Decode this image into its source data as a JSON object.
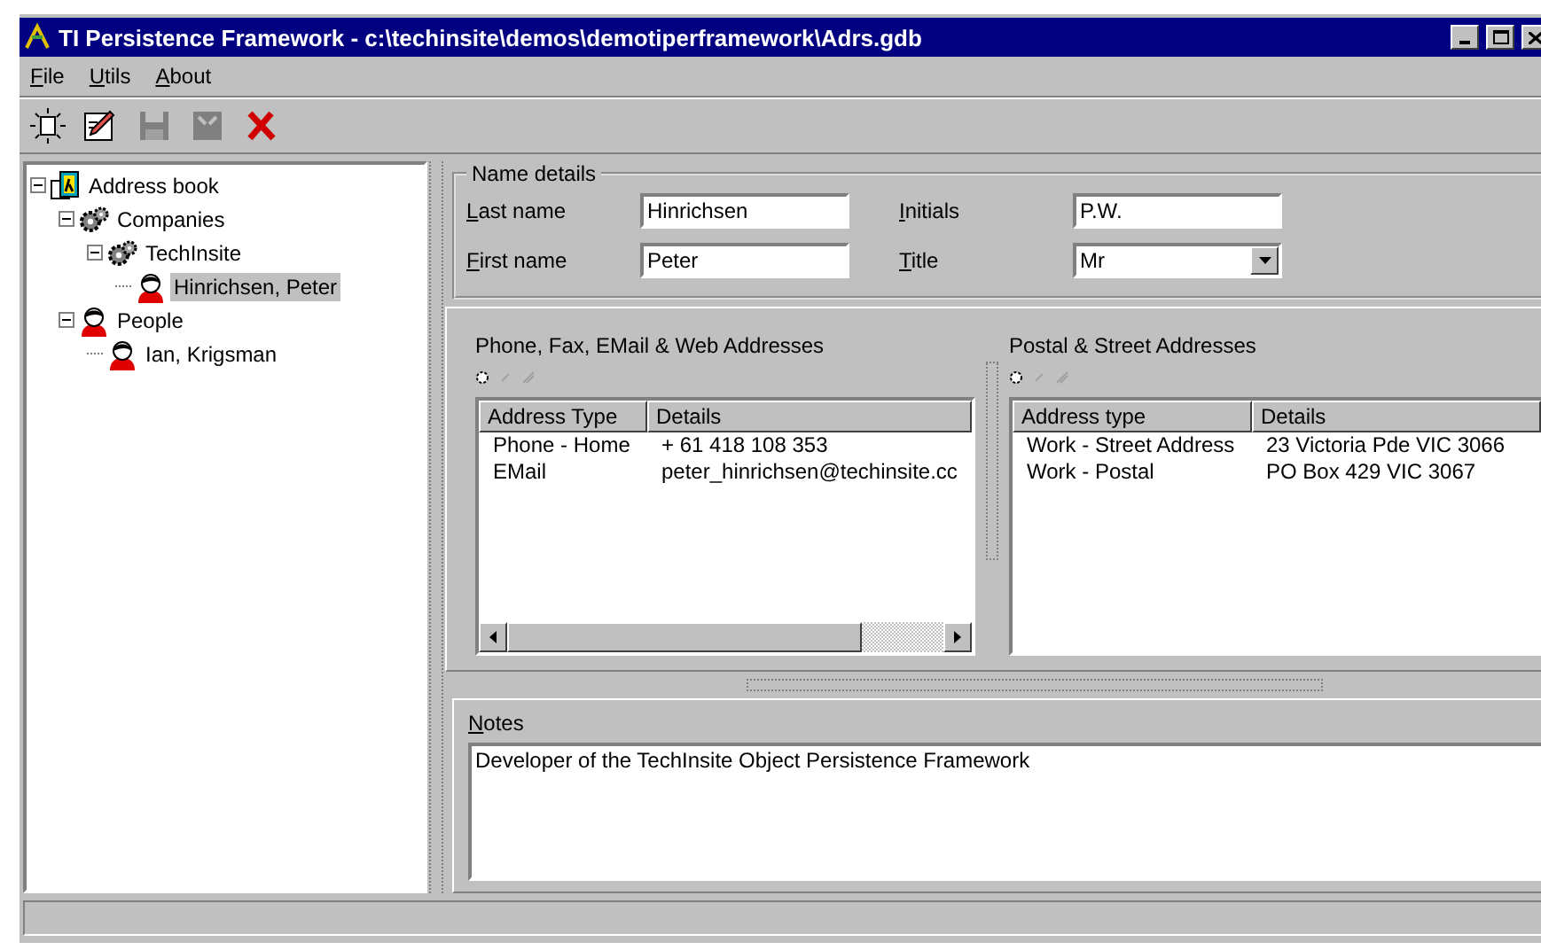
{
  "window": {
    "title": "TI Persistence Framework - c:\\techinsite\\demos\\demotiperframework\\Adrs.gdb"
  },
  "menu": [
    {
      "label": "File"
    },
    {
      "label": "Utils"
    },
    {
      "label": "About"
    }
  ],
  "toolbar": [
    {
      "kind": "new",
      "disabled": false
    },
    {
      "kind": "edit",
      "disabled": false
    },
    {
      "kind": "save",
      "disabled": true
    },
    {
      "kind": "cancel",
      "disabled": true
    },
    {
      "kind": "delete",
      "disabled": false
    }
  ],
  "tree": [
    {
      "label": "Address book",
      "kind": "book",
      "expanded": true,
      "selected": false,
      "children": [
        {
          "label": "Companies",
          "kind": "group",
          "expanded": true,
          "selected": false,
          "children": [
            {
              "label": "TechInsite",
              "kind": "group",
              "expanded": true,
              "selected": false,
              "children": [
                {
                  "label": "Hinrichsen, Peter",
                  "kind": "person",
                  "selected": true
                }
              ]
            }
          ]
        },
        {
          "label": "People",
          "kind": "person",
          "expanded": true,
          "selected": false,
          "children": [
            {
              "label": "Ian, Krigsman",
              "kind": "person",
              "selected": false
            }
          ]
        }
      ]
    }
  ],
  "name_details": {
    "title": "Name details",
    "fields": [
      {
        "label": "Last name",
        "value": "Hinrichsen",
        "kind": "text"
      },
      {
        "label": "Initials",
        "value": "P.W.",
        "kind": "text"
      },
      {
        "label": "First name",
        "value": "Peter",
        "kind": "text"
      },
      {
        "label": "Title",
        "value": "Mr",
        "kind": "select"
      }
    ]
  },
  "phone_list": {
    "title": "Phone, Fax, EMail  & Web Addresses",
    "columns": [
      "Address Type",
      "Details"
    ],
    "rows": [
      [
        "Phone - Home",
        "+ 61 418 108 353"
      ],
      [
        "EMail",
        "peter_hinrichsen@techinsite.cc"
      ]
    ]
  },
  "postal_list": {
    "title": "Postal & Street Addresses",
    "columns": [
      "Address type",
      "Details"
    ],
    "rows": [
      [
        "Work - Street Address",
        "23 Victoria Pde VIC 3066"
      ],
      [
        "Work - Postal",
        "PO Box 429 VIC 3067"
      ]
    ]
  },
  "notes": {
    "label": "Notes",
    "value": "Developer of the TechInsite Object Persistence Framework"
  }
}
